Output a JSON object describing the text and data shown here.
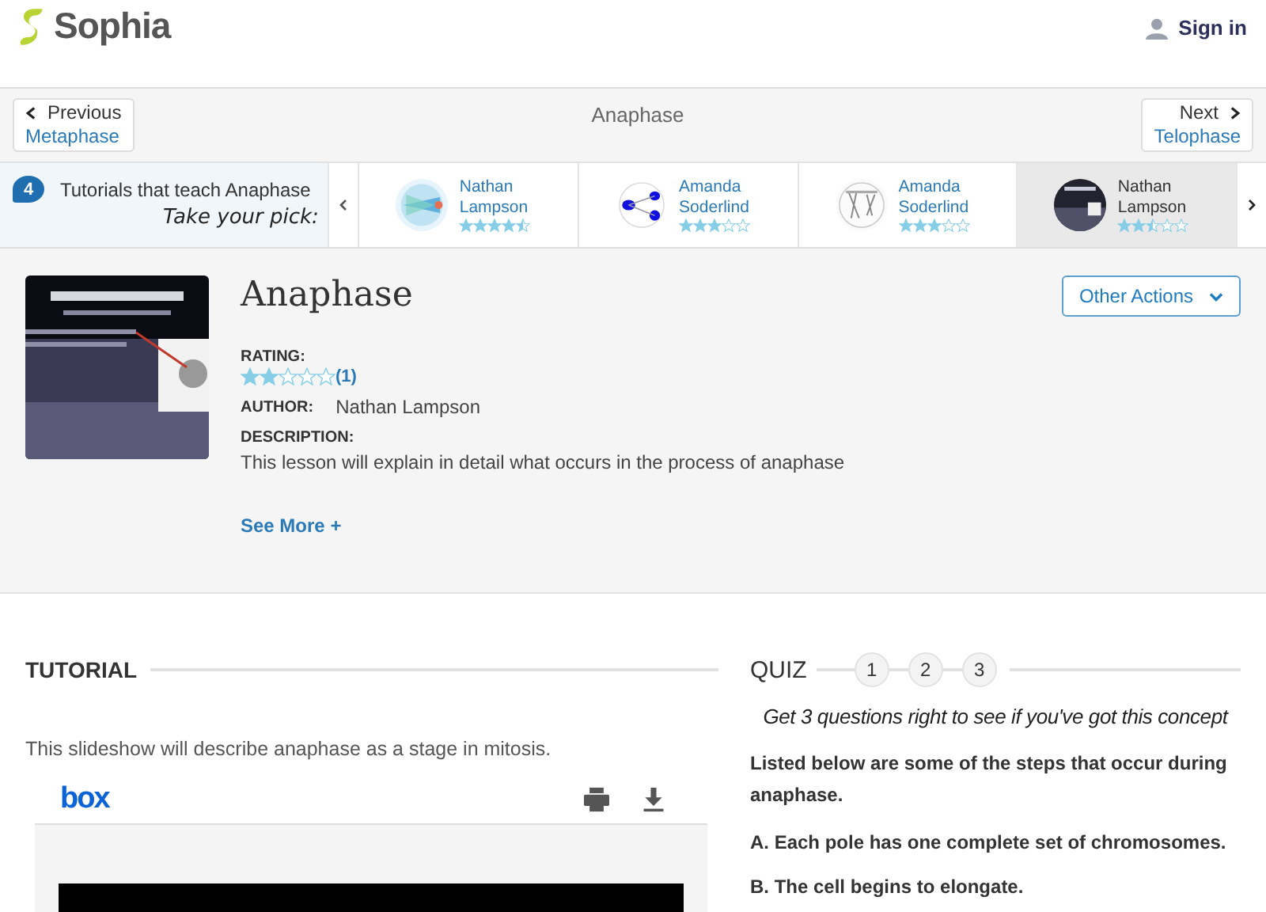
{
  "header": {
    "logo": "Sophia",
    "sign_in": "Sign in"
  },
  "nav": {
    "previous": {
      "label": "Previous",
      "target": "Metaphase"
    },
    "title": "Anaphase",
    "next": {
      "label": "Next",
      "target": "Telophase"
    }
  },
  "tutorials": {
    "count": "4",
    "heading": "Tutorials that teach Anaphase",
    "tagline": "Take your pick:",
    "items": [
      {
        "author": "Nathan Lampson",
        "stars": 4.5,
        "selected": false
      },
      {
        "author": "Amanda Soderlind",
        "stars": 3,
        "selected": false
      },
      {
        "author": "Amanda Soderlind",
        "stars": 3,
        "selected": false
      },
      {
        "author": "Nathan Lampson",
        "stars": 2.5,
        "selected": true
      }
    ]
  },
  "lesson": {
    "title": "Anaphase",
    "actions_button": "Other Actions",
    "rating_label": "RATING:",
    "stars": 2,
    "rating_count": "(1)",
    "author_label": "AUTHOR:",
    "author": "Nathan Lampson",
    "description_label": "DESCRIPTION:",
    "description": "This lesson will explain in detail what occurs in the process of anaphase",
    "see_more": "See More +"
  },
  "tutorial": {
    "heading": "TUTORIAL",
    "intro": "This slideshow will describe anaphase as a stage in mitosis.",
    "viewer": {
      "logo": "box"
    }
  },
  "quiz": {
    "heading": "QUIZ",
    "steps": [
      "1",
      "2",
      "3"
    ],
    "prompt": "Get 3 questions right to see if you've got this concept",
    "question": "Listed below are some of the steps that occur during anaphase.",
    "options": [
      "A. Each pole has one complete set of chromosomes.",
      "B. The cell begins to elongate."
    ]
  }
}
